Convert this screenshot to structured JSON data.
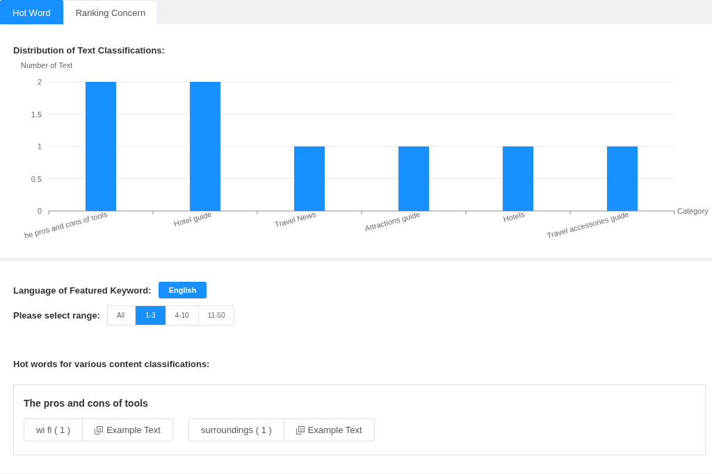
{
  "tabs": [
    {
      "label": "Hot Word",
      "selected": true
    },
    {
      "label": "Ranking Concern",
      "selected": false
    }
  ],
  "distribution": {
    "title": "Distribution of Text Classifications:",
    "chart_data": {
      "type": "bar",
      "ylabel": "Number of Text",
      "xlabel": "Category",
      "categories": [
        "he pros and cons of tools",
        "Hotel guide",
        "Travel News",
        "Attractions guide",
        "Hotels",
        "Travel accessories guide"
      ],
      "series": [
        {
          "color": "#1890ff",
          "values": [
            2,
            2,
            1,
            1,
            1,
            1
          ]
        }
      ],
      "grid": true,
      "ylim": [
        0,
        2
      ],
      "yticks": [
        0,
        0.5,
        1,
        1.5,
        2
      ]
    }
  },
  "language": {
    "label": "Language of Featured Keyword:",
    "value": "English"
  },
  "range": {
    "label": "Please select range:",
    "options": [
      {
        "label": "All",
        "selected": false
      },
      {
        "label": "1-3",
        "selected": true
      },
      {
        "label": "4-10",
        "selected": false
      },
      {
        "label": "11-50",
        "selected": false
      }
    ]
  },
  "hot_words": {
    "title": "Hot words for various content classifications:",
    "groups": [
      {
        "title": "The pros and cons of tools",
        "words": [
          {
            "word": "wi fi ( 1 )",
            "action": "Example Text"
          },
          {
            "word": "surroundings ( 1 )",
            "action": "Example Text"
          }
        ]
      }
    ]
  }
}
